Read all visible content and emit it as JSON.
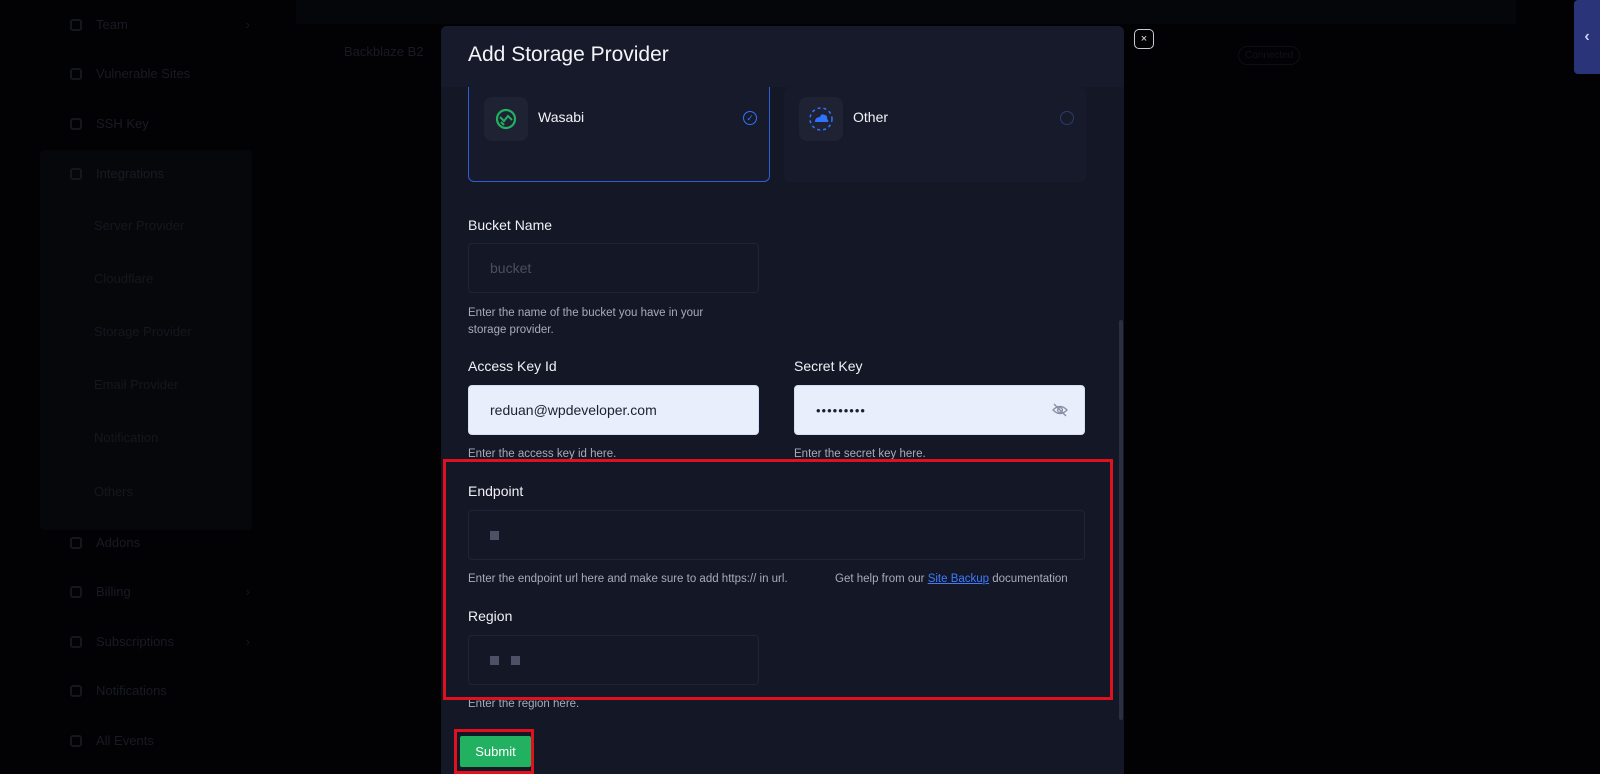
{
  "background": {
    "sidebar": {
      "items": [
        {
          "label": "Team"
        },
        {
          "label": "Vulnerable Sites"
        },
        {
          "label": "SSH Key"
        },
        {
          "label": "Integrations"
        }
      ],
      "integration_subitems": [
        "Server Provider",
        "Cloudflare",
        "Storage Provider",
        "Email Provider",
        "Notification",
        "Others"
      ],
      "lower_items": [
        {
          "label": "Addons"
        },
        {
          "label": "Billing"
        },
        {
          "label": "Subscriptions"
        },
        {
          "label": "Notifications"
        },
        {
          "label": "All Events"
        }
      ]
    },
    "table_row": {
      "name": "Backblaze B2",
      "status": "Connected"
    }
  },
  "modal": {
    "title": "Add Storage Provider",
    "providers": [
      {
        "name": "Wasabi",
        "selected": true,
        "icon": "wasabi-logo-icon",
        "color": "#22b061"
      },
      {
        "name": "Other",
        "selected": false,
        "icon": "cloud-icon",
        "color": "#2e73ff"
      }
    ],
    "bucket": {
      "label": "Bucket Name",
      "placeholder": "bucket",
      "help": "Enter the name of the bucket you have in your storage provider."
    },
    "access_key": {
      "label": "Access Key Id",
      "value": "reduan@wpdeveloper.com",
      "help": "Enter the access key id here."
    },
    "secret_key": {
      "label": "Secret Key",
      "value": "•••••••••",
      "help": "Enter the secret key here."
    },
    "endpoint": {
      "label": "Endpoint",
      "help": "Enter the endpoint url here and make sure to add https:// in url.",
      "help_prefix": "Get help from our",
      "help_link": "Site Backup",
      "help_suffix": "documentation"
    },
    "region": {
      "label": "Region",
      "help": "Enter the region here."
    },
    "submit_label": "Submit"
  },
  "colors": {
    "accent": "#2e73ff",
    "submit": "#22b061",
    "highlight": "#e0111f"
  }
}
